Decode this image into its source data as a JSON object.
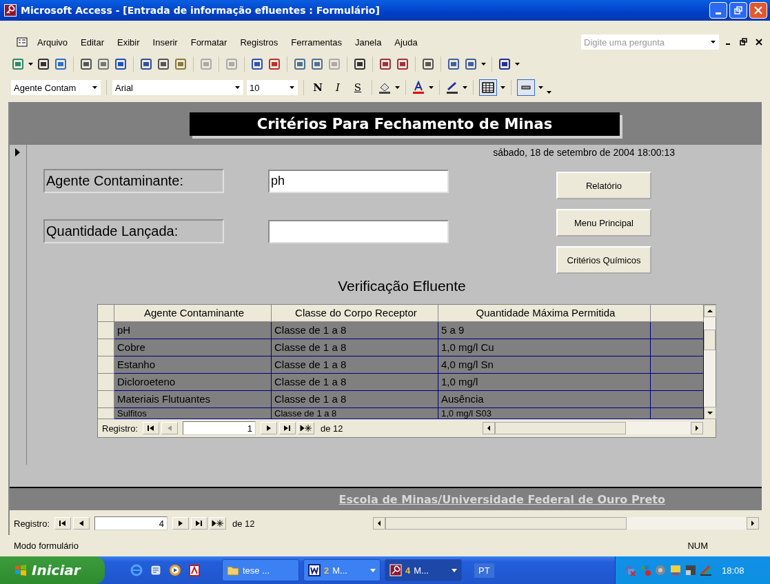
{
  "window": {
    "title": "Microsoft Access - [Entrada de informação efluentes : Formulário]"
  },
  "menu": [
    "Arquivo",
    "Editar",
    "Exibir",
    "Inserir",
    "Formatar",
    "Registros",
    "Ferramentas",
    "Janela",
    "Ajuda"
  ],
  "help_box": {
    "placeholder": "Digite uma pergunta"
  },
  "format_toolbar": {
    "object": "Agente Contam",
    "font": "Arial",
    "size": "10",
    "bold": "N",
    "italic": "I",
    "underline": "S"
  },
  "form": {
    "header": "Critérios Para Fechamento de Minas",
    "date": "sábado, 18 de setembro de 2004 18:00:13",
    "fields": [
      {
        "label": "Agente Contaminante:",
        "value": "ph"
      },
      {
        "label": "Quantidade Lançada:"
      }
    ],
    "buttons": [
      "Relatório",
      "Menu Principal",
      "Critérios Químicos"
    ],
    "subform_title": "Verificação Efluente",
    "subform": {
      "columns": [
        "Agente Contaminante",
        "Classe do Corpo Receptor",
        "Quantidade Máxima Permitida"
      ],
      "rows": [
        [
          "pH",
          "Classe de 1 a 8",
          "5 a 9"
        ],
        [
          "Cobre",
          "Classe de 1 a 8",
          "1,0 mg/l Cu"
        ],
        [
          "Estanho",
          "Classe de 1 a 8",
          "4,0 mg/l Sn"
        ],
        [
          "Dicloroeteno",
          "Classe de 1 a 8",
          "1,0 mg/l"
        ],
        [
          "Materiais Flutuantes",
          "Classe de 1 a 8",
          "Ausência"
        ],
        [
          "Sulfitos",
          "Classe de 1 a 8",
          "1,0 mg/l S03"
        ]
      ],
      "nav": {
        "label": "Registro:",
        "current": "1",
        "total": "de 12"
      }
    },
    "footer": "Escola de Minas/Universidade Federal de Ouro Preto"
  },
  "nav": {
    "label": "Registro:",
    "current": "4",
    "total": "de 12"
  },
  "status_bar": {
    "mode": "Modo formulário",
    "indicator": "NUM"
  },
  "taskbar": {
    "start": "Iniciar",
    "tasks": [
      {
        "label": "tese ...",
        "kind": "folder",
        "selected": false
      },
      {
        "count": "2",
        "label": "M...",
        "kind": "word",
        "selected": false
      },
      {
        "count": "4",
        "label": "M...",
        "kind": "access",
        "selected": true
      }
    ],
    "language": "PT",
    "clock": "18:08"
  }
}
